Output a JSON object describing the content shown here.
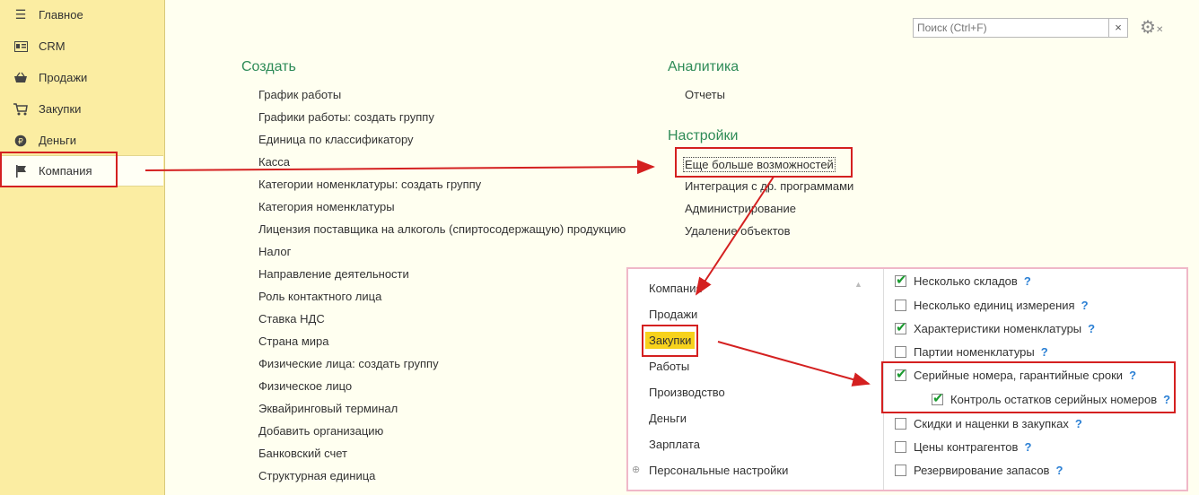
{
  "sidebar": {
    "items": [
      {
        "label": "Главное",
        "icon": "menu-icon"
      },
      {
        "label": "CRM",
        "icon": "crm-card-icon"
      },
      {
        "label": "Продажи",
        "icon": "basket-icon"
      },
      {
        "label": "Закупки",
        "icon": "cart-icon"
      },
      {
        "label": "Деньги",
        "icon": "coin-icon"
      },
      {
        "label": "Компания",
        "icon": "flag-icon"
      }
    ],
    "active": "Компания"
  },
  "search": {
    "placeholder": "Поиск (Ctrl+F)",
    "clear": "×"
  },
  "create": {
    "title": "Создать",
    "items": [
      "График работы",
      "Графики работы: создать группу",
      "Единица по классификатору",
      "Касса",
      "Категории номенклатуры: создать группу",
      "Категория номенклатуры",
      "Лицензия поставщика на алкоголь (спиртосодержащую) продукцию",
      "Налог",
      "Направление деятельности",
      "Роль контактного лица",
      "Ставка НДС",
      "Страна мира",
      "Физические лица: создать группу",
      "Физическое лицо",
      "Эквайринговый терминал",
      "Добавить организацию",
      "Банковский счет",
      "Структурная единица"
    ]
  },
  "analytics": {
    "title": "Аналитика",
    "items": [
      "Отчеты"
    ]
  },
  "settings": {
    "title": "Настройки",
    "items": [
      "Еще больше возможностей",
      "Интеграция с др. программами",
      "Администрирование",
      "Удаление объектов"
    ]
  },
  "panel": {
    "sections": [
      "Компания",
      "Продажи",
      "Закупки",
      "Работы",
      "Производство",
      "Деньги",
      "Зарплата",
      "Персональные настройки"
    ],
    "selected": "Закупки",
    "options": [
      {
        "label": "Несколько складов",
        "checked": true,
        "help": "?"
      },
      {
        "label": "Несколько единиц измерения",
        "checked": false,
        "help": "?"
      },
      {
        "label": "Характеристики номенклатуры",
        "checked": true,
        "help": "?"
      },
      {
        "label": "Партии номенклатуры",
        "checked": false,
        "help": "?"
      },
      {
        "label": "Серийные номера, гарантийные сроки",
        "checked": true,
        "help": "?"
      },
      {
        "label": "Контроль остатков серийных номеров",
        "checked": true,
        "help": "?"
      },
      {
        "label": "Скидки и наценки в закупках",
        "checked": false,
        "help": "?"
      },
      {
        "label": "Цены контрагентов",
        "checked": false,
        "help": "?"
      },
      {
        "label": "Резервирование запасов",
        "checked": false,
        "help": "?"
      }
    ]
  },
  "colors": {
    "annotation": "#d42020",
    "sidebar_bg": "#fbeda2",
    "section_title": "#2e8b57",
    "selected_bg": "#f7d21c",
    "check": "#1a9b2f",
    "help": "#2a7fd4"
  }
}
